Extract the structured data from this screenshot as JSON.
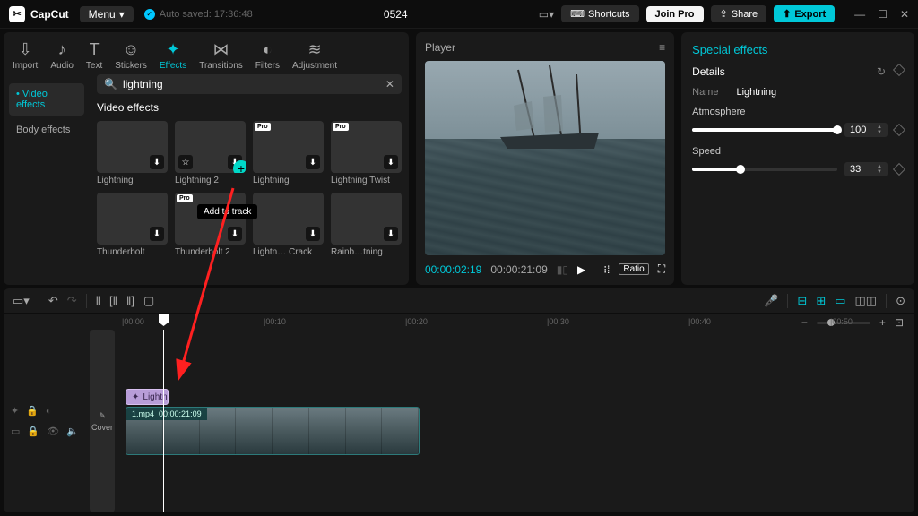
{
  "app": {
    "name": "CapCut"
  },
  "topbar": {
    "menu": "Menu",
    "autosave": "Auto saved: 17:36:48",
    "project": "0524",
    "shortcuts": "Shortcuts",
    "joinpro": "Join Pro",
    "share": "Share",
    "export": "Export"
  },
  "media": {
    "tabs": [
      {
        "icon": "⇩",
        "label": "Import"
      },
      {
        "icon": "♪",
        "label": "Audio"
      },
      {
        "icon": "T",
        "label": "Text"
      },
      {
        "icon": "☺",
        "label": "Stickers"
      },
      {
        "icon": "✦",
        "label": "Effects",
        "active": true
      },
      {
        "icon": "⋈",
        "label": "Transitions"
      },
      {
        "icon": "◐",
        "label": "Filters"
      },
      {
        "icon": "≋",
        "label": "Adjustment"
      }
    ],
    "side": [
      "Video effects",
      "Body effects"
    ],
    "search": "lightning",
    "section": "Video effects",
    "tooltip": "Add to track",
    "items": [
      {
        "name": "Lightning",
        "cls": "g-mtn"
      },
      {
        "name": "Lightning 2",
        "cls": "g-light",
        "add": true,
        "star": true
      },
      {
        "name": "Lightning",
        "cls": "g-person",
        "pro": true
      },
      {
        "name": "Lightning Twist",
        "cls": "g-dark",
        "pro": true
      },
      {
        "name": "Thunderbolt",
        "cls": "g-blue"
      },
      {
        "name": "Thunderbolt 2",
        "cls": "g-yellow",
        "pro": true
      },
      {
        "name": "Lightn… Crack",
        "cls": "g-purple"
      },
      {
        "name": "Rainb…tning",
        "cls": "g-pink"
      }
    ]
  },
  "player": {
    "title": "Player",
    "time_cur": "00:00:02:19",
    "time_dur": "00:00:21:09",
    "ratio": "Ratio"
  },
  "details": {
    "panel_title": "Special effects",
    "section": "Details",
    "name_label": "Name",
    "name_value": "Lightning",
    "params": [
      {
        "label": "Atmosphere",
        "value": 100,
        "pct": 100
      },
      {
        "label": "Speed",
        "value": 33,
        "pct": 33
      }
    ]
  },
  "timeline": {
    "ticks": [
      "|00:00",
      "|00:10",
      "|00:20",
      "|00:30",
      "|00:40",
      "|00:50"
    ],
    "fx_clip": "Lightn",
    "video_clip": {
      "name": "1.mp4",
      "dur": "00:00:21:09"
    },
    "cover": "Cover"
  }
}
